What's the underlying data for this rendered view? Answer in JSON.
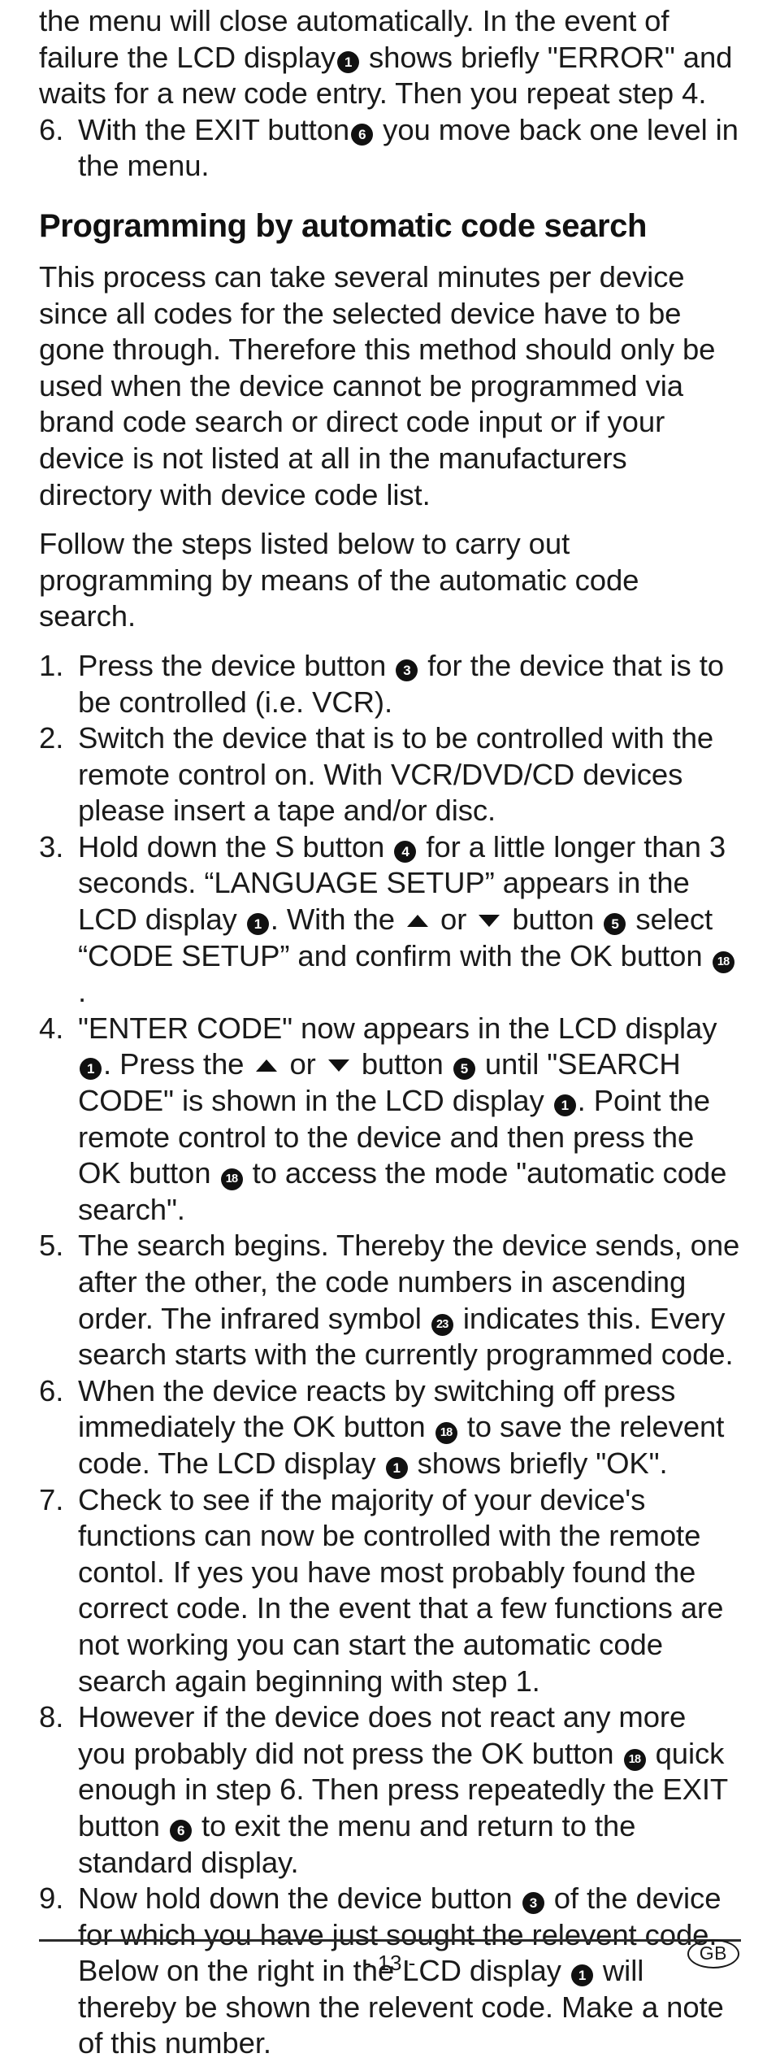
{
  "document": {
    "language_badge": "GB",
    "page_number": "- 13 -"
  },
  "intro": {
    "continuation_line_1": "the menu will close automatically. In the event of failure",
    "continuation_line_2a": "the LCD display",
    "continuation_ref_1": "1",
    "continuation_line_2b": "shows briefly \"ERROR\" and waits for a",
    "continuation_line_3": "new code entry. Then you repeat step 4.",
    "step6_num": "6.",
    "step6_a": "With the EXIT button",
    "step6_ref": "6",
    "step6_b": "you move back one level in the",
    "step6_c": "menu."
  },
  "heading": "Programming by automatic code search",
  "body": {
    "p1": "This process can take several minutes per device since all codes for the selected device have to be gone through. Therefore this method should only be used when the device cannot be programmed via brand code search or direct code input or if your device is not listed at all in the manufacturers directory with device code list.",
    "p2": "Follow the steps listed below to carry out programming by means of the automatic code search."
  },
  "steps": [
    {
      "num": "1.",
      "parts": [
        {
          "t": "text",
          "v": "Press the device button"
        },
        {
          "t": "ref",
          "v": "3"
        },
        {
          "t": "text",
          "v": "for the device that is to be controlled (i.e. VCR)."
        }
      ]
    },
    {
      "num": "2.",
      "parts": [
        {
          "t": "text",
          "v": "Switch the device that is to be controlled with the remote control on. With VCR/DVD/CD devices please insert a tape and/or disc."
        }
      ]
    },
    {
      "num": "3.",
      "parts": [
        {
          "t": "text",
          "v": "Hold down the S button"
        },
        {
          "t": "ref",
          "v": "4"
        },
        {
          "t": "text",
          "v": "for a little longer than 3 seconds. “LANGUAGE SETUP” appears in the LCD display"
        },
        {
          "t": "ref",
          "v": "1"
        },
        {
          "t": "text",
          "v": ". With the"
        },
        {
          "t": "tri-up"
        },
        {
          "t": "text",
          "v": "or"
        },
        {
          "t": "tri-down"
        },
        {
          "t": "text",
          "v": "button"
        },
        {
          "t": "ref",
          "v": "5"
        },
        {
          "t": "text",
          "v": "select “CODE SETUP” and confirm with the OK button"
        },
        {
          "t": "ref",
          "v": "18"
        },
        {
          "t": "text",
          "v": "."
        }
      ]
    },
    {
      "num": "4.",
      "parts": [
        {
          "t": "text",
          "v": "\"ENTER CODE\" now appears in the LCD display"
        },
        {
          "t": "ref",
          "v": "1"
        },
        {
          "t": "text",
          "v": ". Press the"
        },
        {
          "t": "tri-up"
        },
        {
          "t": "text",
          "v": "or"
        },
        {
          "t": "tri-down"
        },
        {
          "t": "text",
          "v": "button"
        },
        {
          "t": "ref",
          "v": "5"
        },
        {
          "t": "text",
          "v": "until \"SEARCH CODE\" is shown in the LCD display"
        },
        {
          "t": "ref",
          "v": "1"
        },
        {
          "t": "text",
          "v": ". Point the remote control to the device and then press the OK button"
        },
        {
          "t": "ref",
          "v": "18"
        },
        {
          "t": "text",
          "v": "to access the mode \"automatic code search\"."
        }
      ]
    },
    {
      "num": "5.",
      "parts": [
        {
          "t": "text",
          "v": "The search begins. Thereby the device sends, one after the other, the code numbers in ascending order. The infrared symbol"
        },
        {
          "t": "ref",
          "v": "23"
        },
        {
          "t": "text",
          "v": "indicates this. Every search starts with the currently programmed code."
        }
      ]
    },
    {
      "num": "6.",
      "parts": [
        {
          "t": "text",
          "v": "When the device reacts by switching off press immediately the OK button"
        },
        {
          "t": "ref",
          "v": "18"
        },
        {
          "t": "text",
          "v": "to save the relevent code. The LCD display"
        },
        {
          "t": "ref",
          "v": "1"
        },
        {
          "t": "text",
          "v": "shows briefly \"OK\"."
        }
      ]
    },
    {
      "num": "7.",
      "parts": [
        {
          "t": "text",
          "v": "Check to see if the majority of your device's functions can now be controlled with the remote contol. If yes you have most probably found the correct code. In the event that a few functions are not working you can start the automatic code search again beginning with step 1."
        }
      ]
    },
    {
      "num": "8.",
      "parts": [
        {
          "t": "text",
          "v": "However if the device does not react any more you probably did not press the OK button"
        },
        {
          "t": "ref",
          "v": "18"
        },
        {
          "t": "text",
          "v": "quick enough in step 6. Then press repeatedly the EXIT button"
        },
        {
          "t": "ref",
          "v": "6"
        },
        {
          "t": "text",
          "v": "to exit the menu and return to the standard display."
        }
      ]
    },
    {
      "num": "9.",
      "parts": [
        {
          "t": "text",
          "v": "Now hold down the device button"
        },
        {
          "t": "ref",
          "v": "3"
        },
        {
          "t": "text",
          "v": "of the device for which you have just sought the relevent code. Below on the right in the LCD display"
        },
        {
          "t": "ref",
          "v": "1"
        },
        {
          "t": "text",
          "v": "will thereby be shown the relevent code. Make a note of this number."
        }
      ]
    }
  ]
}
